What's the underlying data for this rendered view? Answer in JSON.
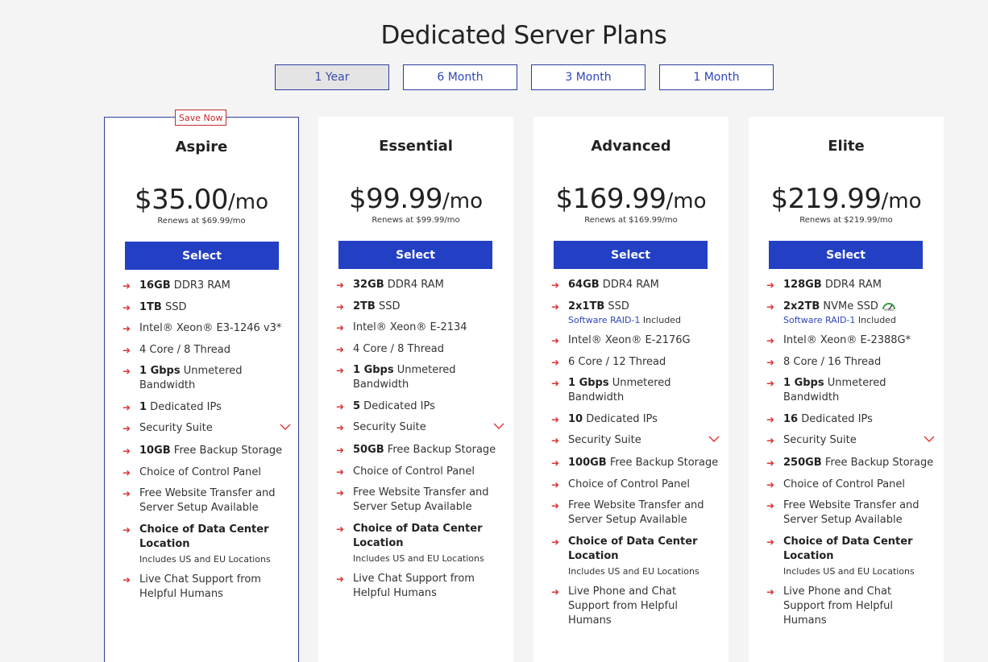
{
  "page": {
    "title": "Dedicated Server Plans"
  },
  "terms": [
    {
      "label": "1 Year",
      "active": true
    },
    {
      "label": "6 Month",
      "active": false
    },
    {
      "label": "3 Month",
      "active": false
    },
    {
      "label": "1 Month",
      "active": false
    }
  ],
  "colors": {
    "accent": "#2340c4",
    "arrow": "#dd3333",
    "badge": "#c62828",
    "link": "#2f46b8"
  },
  "icons": {
    "bullet": "arrow-right-icon",
    "expand": "chevron-down-icon",
    "speed": "speed-gauge-icon"
  },
  "plans": [
    {
      "name": "Aspire",
      "badge": "Save Now",
      "price": "$35.00",
      "per": "/mo",
      "renews": "Renews at $69.99/mo",
      "select_label": "Select",
      "ram": {
        "bold": "16GB",
        "rest": " DDR3 RAM"
      },
      "storage": {
        "bold": "1TB",
        "rest": " SSD",
        "note": ""
      },
      "cpu": "Intel® Xeon® E3-1246 v3*",
      "threads": "4 Core / 8 Thread",
      "bandwidth": {
        "bold": "1 Gbps",
        "rest": " Unmetered Bandwidth"
      },
      "ips": {
        "bold": "1",
        "rest": " Dedicated IPs"
      },
      "security": "Security Suite",
      "backup": {
        "bold": "10GB",
        "rest": " Free Backup Storage"
      },
      "control_panel": "Choice of Control Panel",
      "transfer": "Free Website Transfer and Server Setup Available",
      "datacenter": {
        "title": "Choice of Data Center Location",
        "note": "Includes US and EU Locations"
      },
      "support": "Live Chat Support from Helpful Humans"
    },
    {
      "name": "Essential",
      "badge": "",
      "price": "$99.99",
      "per": "/mo",
      "renews": "Renews at $99.99/mo",
      "select_label": "Select",
      "ram": {
        "bold": "32GB",
        "rest": " DDR4 RAM"
      },
      "storage": {
        "bold": "2TB",
        "rest": " SSD",
        "note": ""
      },
      "cpu": "Intel® Xeon® E-2134",
      "threads": "4 Core / 8 Thread",
      "bandwidth": {
        "bold": "1 Gbps",
        "rest": " Unmetered Bandwidth"
      },
      "ips": {
        "bold": "5",
        "rest": " Dedicated IPs"
      },
      "security": "Security Suite",
      "backup": {
        "bold": "50GB",
        "rest": " Free Backup Storage"
      },
      "control_panel": "Choice of Control Panel",
      "transfer": "Free Website Transfer and Server Setup Available",
      "datacenter": {
        "title": "Choice of Data Center Location",
        "note": "Includes US and EU Locations"
      },
      "support": "Live Chat Support from Helpful Humans"
    },
    {
      "name": "Advanced",
      "badge": "",
      "price": "$169.99",
      "per": "/mo",
      "renews": "Renews at $169.99/mo",
      "select_label": "Select",
      "ram": {
        "bold": "64GB",
        "rest": " DDR4 RAM"
      },
      "storage": {
        "bold": "2x1TB",
        "rest": " SSD",
        "raid": "Software RAID-1",
        "note": " Included"
      },
      "cpu": "Intel® Xeon® E-2176G",
      "threads": "6 Core / 12 Thread",
      "bandwidth": {
        "bold": "1 Gbps",
        "rest": " Unmetered Bandwidth"
      },
      "ips": {
        "bold": "10",
        "rest": " Dedicated IPs"
      },
      "security": "Security Suite",
      "backup": {
        "bold": "100GB",
        "rest": " Free Backup Storage"
      },
      "control_panel": "Choice of Control Panel",
      "transfer": "Free Website Transfer and Server Setup Available",
      "datacenter": {
        "title": "Choice of Data Center Location",
        "note": "Includes US and EU Locations"
      },
      "support": "Live Phone and Chat Support from Helpful Humans"
    },
    {
      "name": "Elite",
      "badge": "",
      "price": "$219.99",
      "per": "/mo",
      "renews": "Renews at $219.99/mo",
      "select_label": "Select",
      "ram": {
        "bold": "128GB",
        "rest": " DDR4 RAM"
      },
      "storage": {
        "bold": "2x2TB",
        "rest": " NVMe SSD",
        "raid": "Software RAID-1",
        "note": " Included"
      },
      "cpu": "Intel® Xeon® E-2388G*",
      "threads": "8 Core / 16 Thread",
      "bandwidth": {
        "bold": "1 Gbps",
        "rest": " Unmetered Bandwidth"
      },
      "ips": {
        "bold": "16",
        "rest": " Dedicated IPs"
      },
      "security": "Security Suite",
      "backup": {
        "bold": "250GB",
        "rest": " Free Backup Storage"
      },
      "control_panel": "Choice of Control Panel",
      "transfer": "Free Website Transfer and Server Setup Available",
      "datacenter": {
        "title": "Choice of Data Center Location",
        "note": "Includes US and EU Locations"
      },
      "support": "Live Phone and Chat Support from Helpful Humans"
    }
  ]
}
